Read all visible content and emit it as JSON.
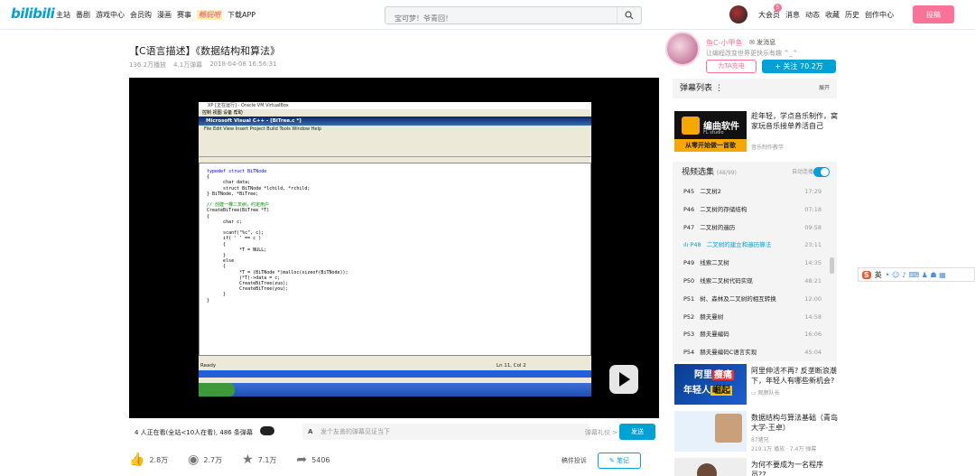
{
  "header": {
    "logo": "bilibili",
    "nav": [
      "主站",
      "番剧",
      "游戏中心",
      "会员购",
      "漫画",
      "赛事",
      "畅玩吧",
      "下载APP"
    ],
    "search_placeholder": "宝可梦！爷青回！",
    "user_nav": [
      "大会员",
      "消息",
      "动态",
      "收藏",
      "历史",
      "创作中心"
    ],
    "msg_count": "5",
    "upload_label": "投稿"
  },
  "video": {
    "title": "【C语言描述】《数据结构和算法》",
    "views": "136.2万播放",
    "danmaku_count": "4.1万弹幕",
    "date": "2018-04-08 16:56:31"
  },
  "vm_window": {
    "title": "XP [正在运行] - Oracle VM VirtualBox",
    "menu": "控制  视图  设备  帮助",
    "vc_title": "Microsoft Visual C++ - [BiTree.c *]",
    "vc_menu": "File  Edit  View  Insert  Project  Build  Tools  Window  Help",
    "status": "Ready",
    "status_pos": "Ln 11, Col 2",
    "code": [
      {
        "t": "typedef struct BiTNode",
        "k": true
      },
      {
        "t": "{"
      },
      {
        "t": "      char data;"
      },
      {
        "t": "      struct BiTNode *lchild, *rchild;"
      },
      {
        "t": "} BiTNode, *BiTree;"
      },
      {
        "t": ""
      },
      {
        "t": "// 创建一棵二叉树，约定用户",
        "c": true
      },
      {
        "t": "CreateBiTree(BiTree *T)"
      },
      {
        "t": "{"
      },
      {
        "t": "      char c;"
      },
      {
        "t": ""
      },
      {
        "t": "      scanf(\"%c\", c);"
      },
      {
        "t": "      if( ' ' == c )"
      },
      {
        "t": "      {"
      },
      {
        "t": "            *T = NULL;"
      },
      {
        "t": "      }"
      },
      {
        "t": "      else"
      },
      {
        "t": "      {"
      },
      {
        "t": "            *T = (BiTNode *)malloc(sizeof(BiTNode));"
      },
      {
        "t": "            (*T)->data = c;"
      },
      {
        "t": "            CreateBiTree(zuo);"
      },
      {
        "t": "            CreateBiTree(you);"
      },
      {
        "t": "      }"
      },
      {
        "t": "}"
      }
    ]
  },
  "controls": {
    "watching": "4 人正在看(全站<10人在看), 486 条弹幕",
    "danmu_placeholder": "发个友善的弹幕见证当下",
    "etiquette": "弹幕礼仪 >",
    "send": "发送"
  },
  "actions": {
    "like": "2.8万",
    "coin": "2.7万",
    "fav": "7.1万",
    "share": "5406",
    "report": "稿件投诉",
    "note": "笔记"
  },
  "uploader": {
    "name": "鱼C-小甲鱼",
    "msg": "发消息",
    "desc": "让编程改变世界更快乐有趣 ^_^",
    "charge": "为TA充电",
    "follow": "+ 关注 70.2万"
  },
  "danmu_list": {
    "label": "弹幕列表",
    "expand": "展开"
  },
  "ad": {
    "img_title": "编曲软件",
    "img_sub": "FL studio",
    "img_banner": "从零开始做一首歌",
    "title": "趁年轻，学点音乐制作，窝家玩音乐接单养活自己",
    "sub": "音乐制作教学"
  },
  "playlist": {
    "label": "视频选集",
    "count": "(48/99)",
    "auto": "自动连播",
    "items": [
      {
        "p": "P45",
        "name": "二叉树2",
        "dur": "17:29"
      },
      {
        "p": "P46",
        "name": "二叉树的存储结构",
        "dur": "07:18"
      },
      {
        "p": "P47",
        "name": "二叉树的遍历",
        "dur": "09:58"
      },
      {
        "p": "P48",
        "name": "二叉树的建立和遍历算法",
        "dur": "23:11",
        "active": true
      },
      {
        "p": "P49",
        "name": "线索二叉树",
        "dur": "14:35"
      },
      {
        "p": "P50",
        "name": "线索二叉树代码实现",
        "dur": "48:21"
      },
      {
        "p": "P51",
        "name": "树、森林及二叉树的相互转换",
        "dur": "12:00"
      },
      {
        "p": "P52",
        "name": "赫夫曼树",
        "dur": "14:58"
      },
      {
        "p": "P53",
        "name": "赫夫曼编码",
        "dur": "16:06"
      },
      {
        "p": "P54",
        "name": "赫夫曼编码C语言实现",
        "dur": "45:04"
      }
    ]
  },
  "recs": [
    {
      "title": "阿里伸活不再? 反垄断浪潮下，年轻人有哪些新机会?",
      "author": "观察队长",
      "stats": ""
    },
    {
      "title": "数据结构与算法基础（青岛大学-王卓）",
      "author": "87猪兄",
      "stats": "219.1万 播放 · 7.4万 弹幕"
    },
    {
      "title": "为何不要成为一名程序员??",
      "author": "",
      "stats": ""
    }
  ]
}
